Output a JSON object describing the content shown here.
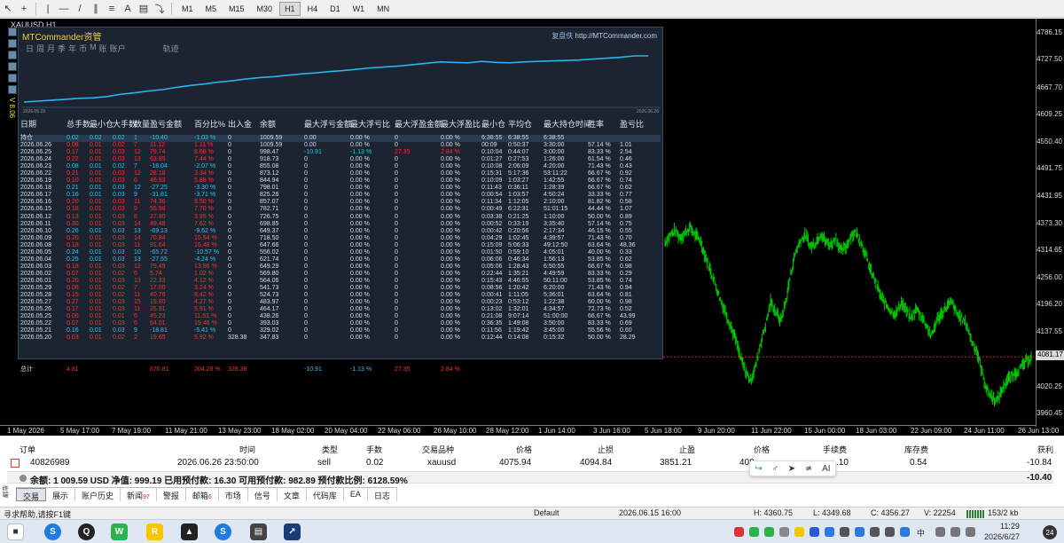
{
  "toolbar": {
    "timeframes": [
      "M1",
      "M5",
      "M15",
      "M30",
      "H1",
      "H4",
      "D1",
      "W1",
      "MN"
    ],
    "active_timeframe": "H1"
  },
  "chart": {
    "title": "XAUUSD,H1",
    "side_label": "V 8.06",
    "price_labels": [
      "4786.15",
      "4727.50",
      "4667.70",
      "4609.25",
      "4550.40",
      "4491.75",
      "4431.95",
      "4373.30",
      "4314.65",
      "4256.00",
      "4196.20",
      "4137.55",
      "4081.17",
      "4020.25",
      "3960.45"
    ],
    "current_price": "4081.17",
    "time_labels": [
      "1 May 2026",
      "5 May 17:00",
      "7 May 19:00",
      "11 May 21:00",
      "13 May 23:00",
      "18 May 02:00",
      "20 May 04:00",
      "22 May 06:00",
      "26 May 10:00",
      "28 May 12:00",
      "1 Jun 14:00",
      "3 Jun 16:00",
      "5 Jun 18:00",
      "9 Jun 20:00",
      "11 Jun 22:00",
      "15 Jun 00:00",
      "18 Jun 03:00",
      "22 Jun 09:00",
      "24 Jun 11:00",
      "26 Jun 13:00"
    ],
    "candle_color": "#00c800",
    "series": {
      "x_start": "2026-06-04",
      "x_end": "2026-06-26",
      "ylim": [
        3960.45,
        4786.15
      ],
      "values": [
        4330,
        4345,
        4355,
        4340,
        4350,
        4362,
        4345,
        4335,
        4300,
        4270,
        4240,
        4205,
        4180,
        4150,
        4120,
        4080,
        4050,
        4030,
        4060,
        4110,
        4150,
        4200,
        4180,
        4160,
        4200,
        4260,
        4310,
        4335,
        4345,
        4320,
        4330,
        4350,
        4330,
        4325,
        4340,
        4310,
        4320,
        4345,
        4350,
        4330,
        4300,
        4265,
        4240,
        4210,
        4195,
        4180,
        4175,
        4200,
        4180,
        4165,
        4185,
        4170,
        4150,
        4125,
        4160,
        4175,
        4190,
        4200,
        4175,
        4165,
        4150,
        4115,
        4095,
        4050,
        4010,
        3995,
        3985,
        4010,
        4030,
        4040,
        4050,
        4060,
        4075,
        4081
      ]
    }
  },
  "panel": {
    "title": "MTCommander资管",
    "link_label": "复盘佚",
    "link_url": "http://MTCommander.com",
    "tabs": [
      "日",
      "周",
      "月",
      "季",
      "年",
      "币",
      "M",
      "账",
      "账户",
      "轨迹"
    ],
    "date_start": "2026.05.29",
    "date_end": "2026.06.26",
    "equity": [
      0.0,
      0.02,
      0.04,
      0.06,
      0.08,
      0.09,
      0.12,
      0.17,
      0.2,
      0.24,
      0.27,
      0.32,
      0.36,
      0.39,
      0.43,
      0.46,
      0.5,
      0.53,
      0.55,
      0.58,
      0.61,
      0.63,
      0.66,
      0.68,
      0.71,
      0.74,
      0.76,
      0.78,
      0.81,
      0.84,
      0.87,
      0.86,
      0.85,
      0.88,
      0.86,
      0.85,
      0.87,
      0.88,
      0.89,
      0.9,
      0.91,
      0.93,
      0.95,
      0.97,
      1.0,
      1.0
    ],
    "headers": [
      "日期",
      "总手数",
      "最小仓",
      "大手数",
      "数量",
      "盈亏金额",
      "百分比%",
      "出入金",
      "余额",
      "最大浮亏金额",
      "最大浮亏比",
      "最大浮盈金额",
      "最大浮盈比",
      "最小仓",
      "平均仓",
      "最大持仓时间",
      "胜率",
      "盈亏比"
    ],
    "rows": [
      {
        "c": [
          "持仓",
          "0.02",
          "0.02",
          "0.02",
          "1",
          "-10.40",
          "-1.03 %",
          "0",
          "1009.59",
          "0.00",
          "0.00 %",
          "0",
          "0.00 %",
          "6:38:55",
          "6:38:55",
          "6:38:55",
          "",
          ""
        ],
        "cls": "cyan",
        "hl": true
      },
      {
        "c": [
          "2026.06.26",
          "0.08",
          "0.01",
          "0.02",
          "7",
          "11.12",
          "1.11 %",
          "0",
          "1009.59",
          "0.00",
          "0.00 %",
          "0",
          "0.00 %",
          "00:09",
          "0:50:37",
          "3:30:00",
          "57.14 %",
          "1.01"
        ],
        "cls": "red"
      },
      {
        "c": [
          "2026.06.25",
          "0.17",
          "0.01",
          "0.03",
          "12",
          "79.74",
          "8.68 %",
          "0",
          "998.47",
          "-10.91",
          "-1.13 %",
          "27.35",
          "2.84 %",
          "0:10:04",
          "0:44:07",
          "3:00:00",
          "83.33 %",
          "2.54"
        ],
        "cls": "red"
      },
      {
        "c": [
          "2026.06.24",
          "0.22",
          "0.01",
          "0.03",
          "13",
          "63.85",
          "7.44 %",
          "0",
          "918.73",
          "0",
          "0.00 %",
          "0",
          "0.00 %",
          "0:01:27",
          "0:27:53",
          "1:26:00",
          "61.54 %",
          "0.46"
        ],
        "cls": "red"
      },
      {
        "c": [
          "2026.06.23",
          "0.08",
          "0.01",
          "0.02",
          "7",
          "-18.04",
          "-2.07 %",
          "0",
          "855.08",
          "0",
          "0.00 %",
          "0",
          "0.00 %",
          "0:10:08",
          "2:06:09",
          "4:20:00",
          "71.43 %",
          "0.43"
        ],
        "cls": "cyan"
      },
      {
        "c": [
          "2026.06.22",
          "0.21",
          "0.01",
          "0.03",
          "12",
          "28.18",
          "3.34 %",
          "0",
          "873.12",
          "0",
          "0.00 %",
          "0",
          "0.00 %",
          "0:15:31",
          "5:17:36",
          "53:11:22",
          "66.67 %",
          "0.92"
        ],
        "cls": "red"
      },
      {
        "c": [
          "2026.06.19",
          "0.10",
          "0.01",
          "0.03",
          "6",
          "46.93",
          "5.88 %",
          "0",
          "844.94",
          "0",
          "0.00 %",
          "0",
          "0.00 %",
          "0:10:09",
          "1:03:27",
          "1:42:55",
          "66.67 %",
          "0.74"
        ],
        "cls": "red"
      },
      {
        "c": [
          "2026.06.18",
          "0.21",
          "0.01",
          "0.03",
          "12",
          "-27.25",
          "-3.30 %",
          "0",
          "798.01",
          "0",
          "0.00 %",
          "0",
          "0.00 %",
          "0:11:43",
          "0:36:11",
          "1:28:39",
          "66.67 %",
          "0.62"
        ],
        "cls": "cyan"
      },
      {
        "c": [
          "2026.06.17",
          "0.16",
          "0.01",
          "0.03",
          "9",
          "-31.81",
          "-3.71 %",
          "0",
          "825.26",
          "0",
          "0.00 %",
          "0",
          "0.00 %",
          "0:00:54",
          "1:03:57",
          "4:50:24",
          "33.33 %",
          "0.77"
        ],
        "cls": "cyan"
      },
      {
        "c": [
          "2026.06.16",
          "0.20",
          "0.01",
          "0.03",
          "11",
          "74.36",
          "9.50 %",
          "0",
          "857.07",
          "0",
          "0.00 %",
          "0",
          "0.00 %",
          "0:11:34",
          "1:12:05",
          "2:10:00",
          "81.82 %",
          "0.58"
        ],
        "cls": "red"
      },
      {
        "c": [
          "2026.06.15",
          "0.18",
          "0.01",
          "0.03",
          "9",
          "55.98",
          "7.70 %",
          "0",
          "782.71",
          "0",
          "0.00 %",
          "0",
          "0.00 %",
          "0:00:49",
          "6:22:31",
          "51:01:15",
          "44.44 %",
          "1.07"
        ],
        "cls": "red"
      },
      {
        "c": [
          "2026.06.12",
          "0.13",
          "0.01",
          "0.03",
          "8",
          "27.90",
          "3.99 %",
          "0",
          "726.75",
          "0",
          "0.00 %",
          "0",
          "0.00 %",
          "0:03:38",
          "0:21:25",
          "1:10:00",
          "50.00 %",
          "0.89"
        ],
        "cls": "red"
      },
      {
        "c": [
          "2026.06.11",
          "0.30",
          "0.01",
          "0.03",
          "14",
          "49.48",
          "7.62 %",
          "0",
          "698.85",
          "0",
          "0.00 %",
          "0",
          "0.00 %",
          "0:00:52",
          "0:33:19",
          "3:35:40",
          "57.14 %",
          "0.75"
        ],
        "cls": "red"
      },
      {
        "c": [
          "2026.06.10",
          "0.26",
          "0.01",
          "0.03",
          "13",
          "-69.13",
          "-9.62 %",
          "0",
          "649.37",
          "0",
          "0.00 %",
          "0",
          "0.00 %",
          "0:00:42",
          "0:20:56",
          "2:17:34",
          "46.15 %",
          "0.55"
        ],
        "cls": "cyan"
      },
      {
        "c": [
          "2026.06.09",
          "0.20",
          "0.01",
          "0.03",
          "14",
          "70.84",
          "10.54 %",
          "0",
          "718.50",
          "0",
          "0.00 %",
          "0",
          "0.00 %",
          "0:04:29",
          "1:02:45",
          "4:39:57",
          "71.43 %",
          "0.70"
        ],
        "cls": "red"
      },
      {
        "c": [
          "2026.06.08",
          "0.18",
          "0.01",
          "0.03",
          "11",
          "91.64",
          "16.48 %",
          "0",
          "647.66",
          "0",
          "0.00 %",
          "0",
          "0.00 %",
          "0:15:09",
          "5:06:33",
          "49:12:50",
          "63.64 %",
          "48.36"
        ],
        "cls": "red"
      },
      {
        "c": [
          "2026.06.05",
          "0.24",
          "0.01",
          "0.03",
          "10",
          "-65.72",
          "-10.57 %",
          "0",
          "556.02",
          "0",
          "0.00 %",
          "0",
          "0.00 %",
          "0:01:50",
          "0:59:10",
          "4:05:01",
          "40.00 %",
          "0.33"
        ],
        "cls": "cyan"
      },
      {
        "c": [
          "2026.06.04",
          "0.25",
          "0.01",
          "0.03",
          "13",
          "-27.55",
          "-4.24 %",
          "0",
          "621.74",
          "0",
          "0.00 %",
          "0",
          "0.00 %",
          "0:06:06",
          "0:46:34",
          "1:56:13",
          "53.85 %",
          "0.62"
        ],
        "cls": "cyan"
      },
      {
        "c": [
          "2026.06.03",
          "0.18",
          "0.01",
          "0.03",
          "12",
          "79.49",
          "13.96 %",
          "0",
          "649.29",
          "0",
          "0.00 %",
          "0",
          "0.00 %",
          "0:05:06",
          "1:28:43",
          "6:50:55",
          "66.67 %",
          "0.98"
        ],
        "cls": "red"
      },
      {
        "c": [
          "2026.06.02",
          "0.07",
          "0.01",
          "0.02",
          "6",
          "5.74",
          "1.02 %",
          "0",
          "569.80",
          "0",
          "0.00 %",
          "0",
          "0.00 %",
          "0:22:44",
          "1:35:21",
          "4:49:59",
          "83.33 %",
          "0.29"
        ],
        "cls": "red"
      },
      {
        "c": [
          "2026.06.01",
          "0.20",
          "0.01",
          "0.03",
          "13",
          "22.33",
          "4.12 %",
          "0",
          "564.06",
          "0",
          "0.00 %",
          "0",
          "0.00 %",
          "0:15:43",
          "4:46:55",
          "50:11:00",
          "53.85 %",
          "0.74"
        ],
        "cls": "red"
      },
      {
        "c": [
          "2026.05.29",
          "0.08",
          "0.01",
          "0.02",
          "7",
          "17.00",
          "3.24 %",
          "0",
          "541.73",
          "0",
          "0.00 %",
          "0",
          "0.00 %",
          "0:08:56",
          "1:20:42",
          "6:20:00",
          "71.43 %",
          "0.94"
        ],
        "cls": "red"
      },
      {
        "c": [
          "2026.05.28",
          "0.15",
          "0.01",
          "0.02",
          "11",
          "40.76",
          "8.42 %",
          "0",
          "524.73",
          "0",
          "0.00 %",
          "0",
          "0.00 %",
          "0:00:41",
          "1:11:05",
          "5:36:01",
          "63.64 %",
          "0.81"
        ],
        "cls": "red"
      },
      {
        "c": [
          "2026.05.27",
          "0.27",
          "0.01",
          "0.03",
          "15",
          "19.80",
          "4.27 %",
          "0",
          "483.97",
          "0",
          "0.00 %",
          "0",
          "0.00 %",
          "0:00:23",
          "0:53:12",
          "1:22:38",
          "60.00 %",
          "0.98"
        ],
        "cls": "red"
      },
      {
        "c": [
          "2026.05.26",
          "0.17",
          "0.01",
          "0.03",
          "11",
          "25.91",
          "5.91 %",
          "0",
          "464.17",
          "0",
          "0.00 %",
          "0",
          "0.00 %",
          "0:13:02",
          "1:32:01",
          "4:34:57",
          "72.73 %",
          "0.52"
        ],
        "cls": "red"
      },
      {
        "c": [
          "2026.05.25",
          "0.06",
          "0.01",
          "0.01",
          "6",
          "45.23",
          "11.51 %",
          "0",
          "438.26",
          "0",
          "0.00 %",
          "0",
          "0.00 %",
          "0:21:08",
          "9:07:14",
          "51:00:00",
          "66.67 %",
          "43.99"
        ],
        "cls": "red"
      },
      {
        "c": [
          "2026.05.22",
          "0.07",
          "0.01",
          "0.03",
          "6",
          "64.01",
          "19.46 %",
          "0",
          "393.03",
          "0",
          "0.00 %",
          "0",
          "0.00 %",
          "0:36:35",
          "1:49:08",
          "3:50:00",
          "83.33 %",
          "0.69"
        ],
        "cls": "red"
      },
      {
        "c": [
          "2026.05.21",
          "0.16",
          "0.01",
          "0.03",
          "9",
          "-18.81",
          "-5.41 %",
          "0",
          "329.02",
          "0",
          "0.00 %",
          "0",
          "0.00 %",
          "0:11:56",
          "1:19:42",
          "3:45:00",
          "55.56 %",
          "0.60"
        ],
        "cls": "cyan"
      },
      {
        "c": [
          "2026.05.20",
          "0.03",
          "0.01",
          "0.02",
          "2",
          "19.65",
          "5.92 %",
          "328.38",
          "347.83",
          "0",
          "0.00 %",
          "0",
          "0.00 %",
          "0:12:44",
          "0:14:08",
          "0:15:32",
          "50.00 %",
          "28.29"
        ],
        "cls": "red"
      }
    ],
    "total": {
      "label": "总计",
      "lots": "4.81",
      "pnl": "670.81",
      "pct": "204.28 %",
      "deposit": "328.38",
      "max_loss": "-10.91",
      "max_loss_pct": "-1.13 %",
      "max_profit": "27.35",
      "max_profit_pct": "2.84 %"
    }
  },
  "terminal": {
    "headers": {
      "order": "订单",
      "time": "时间",
      "type": "类型",
      "volume": "手数",
      "symbol": "交易品种",
      "price": "价格",
      "sl": "止损",
      "tp": "止盈",
      "price2": "价格",
      "commission": "手续费",
      "swap": "库存费",
      "profit": "获利"
    },
    "order": {
      "id": "40826989",
      "time": "2026.06.26 23:50:00",
      "type": "sell",
      "volume": "0.02",
      "symbol": "xauusd",
      "price": "4075.94",
      "sl": "4094.84",
      "tp": "3851.21",
      "cur": "408",
      "commission": ".10",
      "swap": "0.54",
      "profit": "-10.84"
    },
    "balance_text": "余额: 1 009.59 USD  净值: 999.19  已用预付款: 16.30  可用预付款: 982.89  预付款比例: 6128.59%",
    "balance_profit": "-10.40",
    "side_label": "终端",
    "tabs": [
      {
        "label": "交易",
        "badge": ""
      },
      {
        "label": "展示",
        "badge": ""
      },
      {
        "label": "账户历史",
        "badge": ""
      },
      {
        "label": "新闻",
        "badge": "97"
      },
      {
        "label": "警报",
        "badge": ""
      },
      {
        "label": "邮箱",
        "badge": "6"
      },
      {
        "label": "市场",
        "badge": ""
      },
      {
        "label": "信号",
        "badge": ""
      },
      {
        "label": "文章",
        "badge": ""
      },
      {
        "label": "代码库",
        "badge": ""
      },
      {
        "label": "EA",
        "badge": ""
      },
      {
        "label": "日志",
        "badge": ""
      }
    ],
    "float_ai": "AI"
  },
  "statusbar": {
    "help": "寻求帮助,请按F1键",
    "profile": "Default",
    "datetime": "2026.06.15 16:00",
    "high": "H: 4360.75",
    "low": "L: 4349.68",
    "close": "C: 4356.27",
    "volume": "V: 22254",
    "traffic": "153/2 kb"
  },
  "taskbar": {
    "time": "11:29",
    "date": "2026/6/27",
    "lang": "中",
    "notifications": "24"
  }
}
